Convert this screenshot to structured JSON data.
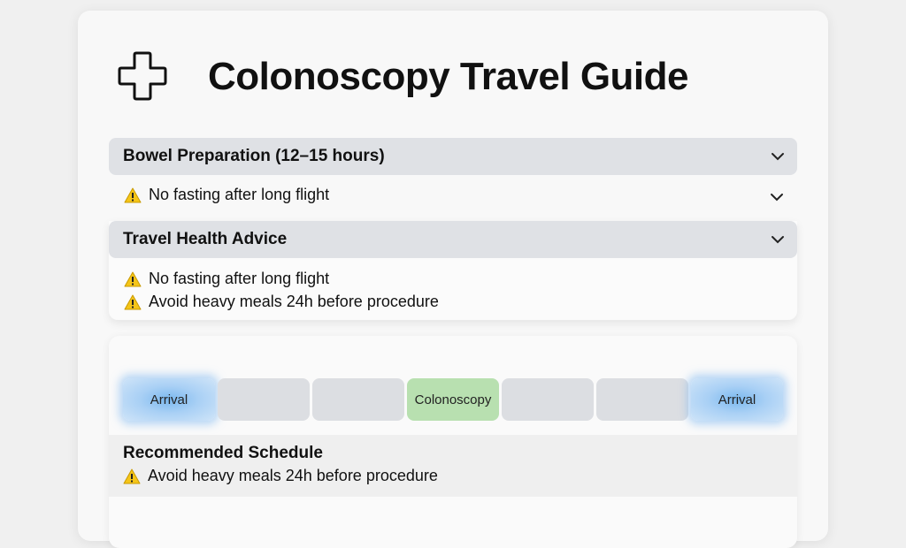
{
  "header": {
    "title": "Colonoscopy Travel Guide",
    "icon": "medical-cross-icon"
  },
  "sections": {
    "bowel_prep": {
      "title": "Bowel Preparation (12–15 hours)",
      "items": [
        "No fasting after long flight"
      ]
    },
    "travel_health": {
      "title": "Travel Health Advice",
      "items": [
        "No fasting after long flight",
        "Avoid heavy meals 24h before procedure"
      ]
    }
  },
  "timeline": {
    "cells": [
      {
        "label": "Arrival",
        "kind": "arrival"
      },
      {
        "label": "",
        "kind": "empty"
      },
      {
        "label": "",
        "kind": "empty"
      },
      {
        "label": "Colonoscopy",
        "kind": "procedure"
      },
      {
        "label": "",
        "kind": "empty"
      },
      {
        "label": "",
        "kind": "empty"
      },
      {
        "label": "Arrival",
        "kind": "arrival"
      }
    ]
  },
  "schedule": {
    "title": "Recommended Schedule",
    "items": [
      "Avoid heavy meals 24h before procedure"
    ]
  },
  "colors": {
    "section_header_bg": "#dfe1e5",
    "arrival_blue": "#7ab8ee",
    "procedure_green": "#b8e0b0",
    "warning_yellow": "#f5c518"
  }
}
